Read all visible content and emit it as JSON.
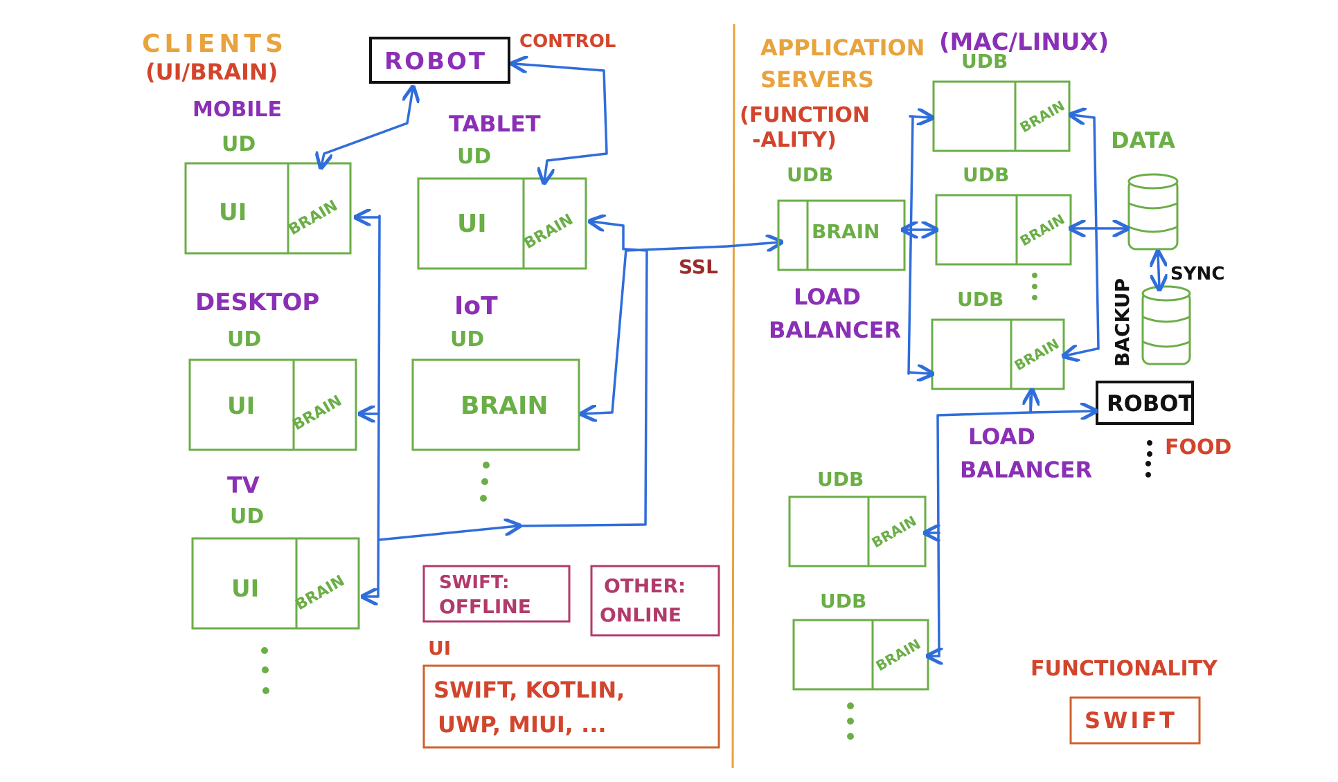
{
  "colors": {
    "clients_heading": "#e8a33d",
    "clients_sub": "#d2452c",
    "device_label": "#8a2fb6",
    "ud_box": "#6aae46",
    "arrow": "#2f6ddb",
    "divider": "#e8a33d"
  },
  "clients": {
    "title": "CLIENTS",
    "subtitle": "(UI/BRAIN)",
    "mobile": "MOBILE",
    "tablet": "TABLET",
    "desktop": "DESKTOP",
    "iot": "IoT",
    "tv": "TV",
    "ud": "UD",
    "ui": "UI",
    "brain": "BRAIN",
    "robot": "ROBOT",
    "control": "CONTROL"
  },
  "ssl": "SSL",
  "notes": {
    "swift_offline_1": "SWIFT:",
    "swift_offline_2": "OFFLINE",
    "other_online_1": "OTHER:",
    "other_online_2": "ONLINE",
    "ui_label": "UI",
    "ui_langs_1": "SWIFT, KOTLIN,",
    "ui_langs_2": "UWP, MIUI, ..."
  },
  "servers": {
    "title_1": "APPLICATION",
    "title_2": "SERVERS",
    "os": "(MAC/LINUX)",
    "func_1": "(FUNCTION",
    "func_2": "-ALITY)",
    "udb": "UDB",
    "brain": "BRAIN",
    "load_1": "LOAD",
    "balancer": "BALANCER",
    "data": "DATA",
    "sync": "SYNC",
    "backup": "BACKUP",
    "robot": "ROBOT",
    "food": "FOOD",
    "functionality": "FUNCTIONALITY",
    "swift": "SWIFT"
  }
}
